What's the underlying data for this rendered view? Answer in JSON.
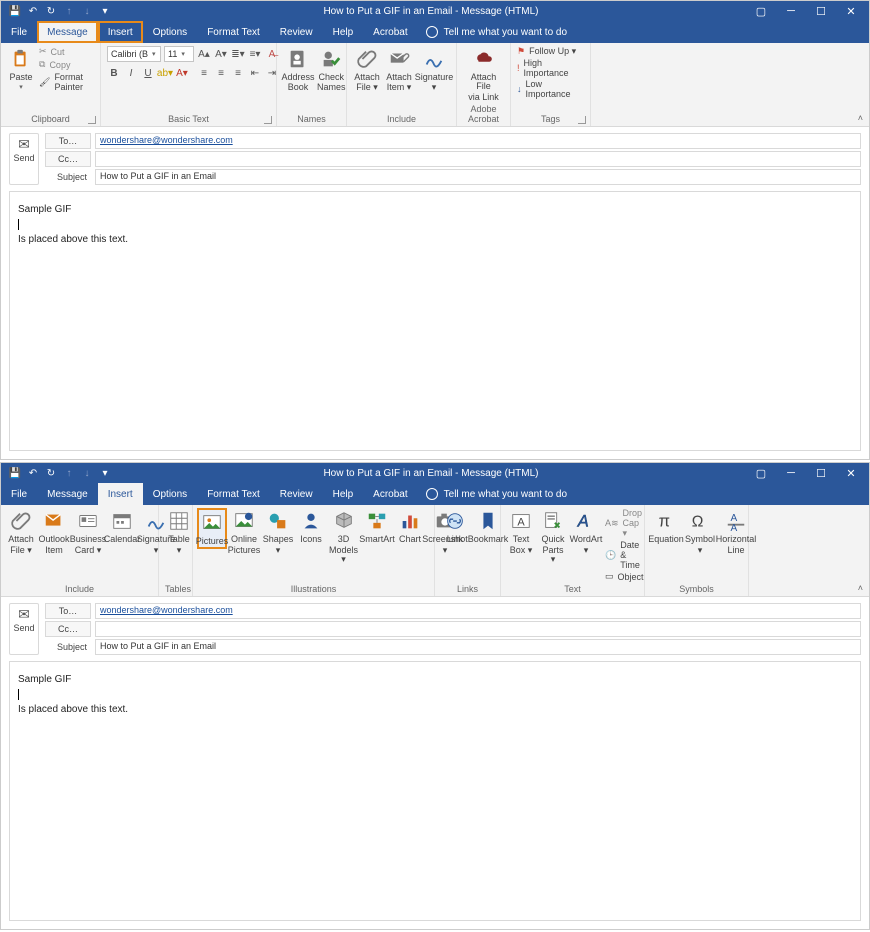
{
  "title": "How to Put a GIF in an Email - Message (HTML)",
  "tellme": "Tell me what you want to do",
  "tabs": [
    "File",
    "Message",
    "Insert",
    "Options",
    "Format Text",
    "Review",
    "Help",
    "Acrobat"
  ],
  "message_ribbon": {
    "clipboard": {
      "label": "Clipboard",
      "paste": "Paste",
      "cut": "Cut",
      "copy": "Copy",
      "fp": "Format Painter"
    },
    "basictext": {
      "label": "Basic Text",
      "font": "Calibri (B",
      "size": "11"
    },
    "names": {
      "label": "Names",
      "ab1": "Address",
      "ab2": "Book",
      "cn1": "Check",
      "cn2": "Names"
    },
    "include": {
      "label": "Include",
      "af1": "Attach",
      "af2": "File ▾",
      "ai1": "Attach",
      "ai2": "Item ▾",
      "sig": "Signature",
      "sig2": "▾"
    },
    "adobe": {
      "label": "Adobe Acrobat",
      "l1": "Attach File",
      "l2": "via Link"
    },
    "tags": {
      "label": "Tags",
      "fu": "Follow Up ▾",
      "hi": "High Importance",
      "lo": "Low Importance"
    }
  },
  "insert_ribbon": {
    "include": {
      "label": "Include",
      "af1": "Attach",
      "af2": "File ▾",
      "oi1": "Outlook",
      "oi2": "Item",
      "bc1": "Business",
      "bc2": "Card ▾",
      "cal": "Calendar",
      "sig": "Signature",
      "sig2": "▾"
    },
    "tables": {
      "label": "Tables",
      "tb1": "Table",
      "tb2": "▾"
    },
    "illus": {
      "label": "Illustrations",
      "pic": "Pictures",
      "op1": "Online",
      "op2": "Pictures",
      "sh1": "Shapes",
      "sh2": "▾",
      "ic": "Icons",
      "md1": "3D",
      "md2": "Models ▾",
      "sa": "SmartArt",
      "ch": "Chart",
      "ss": "Screenshot",
      "ss2": "▾"
    },
    "links": {
      "label": "Links",
      "lk": "Link",
      "bm": "Bookmark"
    },
    "text": {
      "label": "Text",
      "tb1": "Text",
      "tb2": "Box ▾",
      "qp1": "Quick",
      "qp2": "Parts ▾",
      "wa1": "WordArt",
      "wa2": "▾",
      "dc": "Drop Cap ▾",
      "dt": "Date & Time",
      "ob": "Object"
    },
    "symbols": {
      "label": "Symbols",
      "eq": "Equation",
      "sy": "Symbol",
      "sy2": "▾",
      "hl1": "Horizontal",
      "hl2": "Line"
    }
  },
  "addr": {
    "send": "Send",
    "to": "To…",
    "cc": "Cc…",
    "subject": "Subject",
    "to_val": "wondershare@wondershare.com",
    "cc_val": "",
    "subject_val": "How to Put a GIF in an Email"
  },
  "body": {
    "l1": "Sample GIF",
    "l2": "Is placed above this text."
  }
}
